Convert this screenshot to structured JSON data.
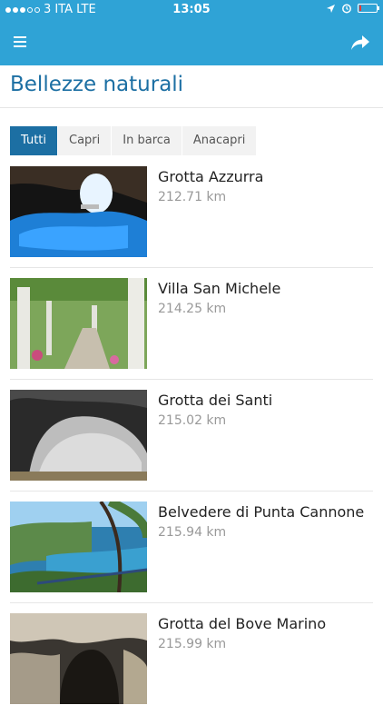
{
  "status_bar": {
    "carrier": "3 ITA",
    "network": "LTE",
    "time": "13:05",
    "battery_level": 0.1
  },
  "nav": {
    "menu_icon": "menu-icon",
    "share_icon": "share-icon"
  },
  "page": {
    "title": "Bellezze naturali"
  },
  "tabs": [
    {
      "label": "Tutti",
      "active": true
    },
    {
      "label": "Capri",
      "active": false
    },
    {
      "label": "In barca",
      "active": false
    },
    {
      "label": "Anacapri",
      "active": false
    }
  ],
  "places": [
    {
      "name": "Grotta Azzurra",
      "distance": "212.71 km"
    },
    {
      "name": "Villa San Michele",
      "distance": "214.25 km"
    },
    {
      "name": "Grotta dei Santi",
      "distance": "215.02 km"
    },
    {
      "name": "Belvedere di Punta Cannone",
      "distance": "215.94 km"
    },
    {
      "name": "Grotta del Bove Marino",
      "distance": "215.99 km"
    }
  ],
  "colors": {
    "header": "#2fa3d6",
    "accent": "#1c6fa3",
    "battery_low": "#e53935"
  }
}
